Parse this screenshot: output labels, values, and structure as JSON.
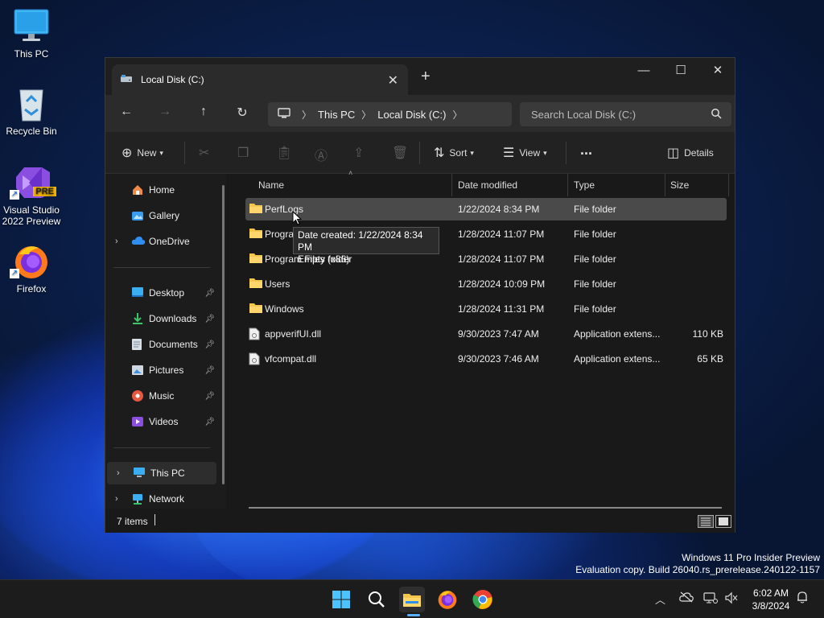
{
  "desktop": {
    "icons": [
      {
        "label": "This PC"
      },
      {
        "label": "Recycle Bin"
      },
      {
        "label": "Visual Studio 2022 Preview",
        "badge": "PRE"
      },
      {
        "label": "Firefox"
      }
    ]
  },
  "window": {
    "tab_title": "Local Disk (C:)",
    "address": {
      "crumbs": [
        "This PC",
        "Local Disk (C:)"
      ]
    },
    "search_placeholder": "Search Local Disk (C:)",
    "commands": {
      "new": "New",
      "sort": "Sort",
      "view": "View",
      "more": "...",
      "details": "Details"
    }
  },
  "sidebar": {
    "quick": [
      {
        "label": "Home"
      },
      {
        "label": "Gallery"
      },
      {
        "label": "OneDrive"
      }
    ],
    "pinned": [
      {
        "label": "Desktop"
      },
      {
        "label": "Downloads"
      },
      {
        "label": "Documents"
      },
      {
        "label": "Pictures"
      },
      {
        "label": "Music"
      },
      {
        "label": "Videos"
      }
    ],
    "drives": [
      {
        "label": "This PC"
      },
      {
        "label": "Network"
      }
    ]
  },
  "columns": [
    "Name",
    "Date modified",
    "Type",
    "Size"
  ],
  "files": [
    {
      "name": "PerfLogs",
      "date": "1/22/2024 8:34 PM",
      "type": "File folder",
      "size": "",
      "kind": "folder"
    },
    {
      "name": "Progra",
      "date": "1/28/2024 11:07 PM",
      "type": "File folder",
      "size": "",
      "kind": "folder"
    },
    {
      "name": "Program Files (x86)",
      "date": "1/28/2024 11:07 PM",
      "type": "File folder",
      "size": "",
      "kind": "folder"
    },
    {
      "name": "Users",
      "date": "1/28/2024 10:09 PM",
      "type": "File folder",
      "size": "",
      "kind": "folder"
    },
    {
      "name": "Windows",
      "date": "1/28/2024 11:31 PM",
      "type": "File folder",
      "size": "",
      "kind": "folder"
    },
    {
      "name": "appverifUI.dll",
      "date": "9/30/2023 7:47 AM",
      "type": "Application extens...",
      "size": "110 KB",
      "kind": "dll"
    },
    {
      "name": "vfcompat.dll",
      "date": "9/30/2023 7:46 AM",
      "type": "Application extens...",
      "size": "65 KB",
      "kind": "dll"
    }
  ],
  "tooltip": {
    "line1": "Date created: 1/22/2024 8:34 PM",
    "line2": "Empty folder"
  },
  "status": {
    "count": "7 items"
  },
  "watermark": {
    "line1": "Windows 11 Pro Insider Preview",
    "line2": "Evaluation copy. Build 26040.rs_prerelease.240122-1157"
  },
  "clock": {
    "time": "6:02 AM",
    "date": "3/8/2024"
  },
  "colors": {
    "accent": "#5ab0ff",
    "folder": "#f4c64e"
  }
}
